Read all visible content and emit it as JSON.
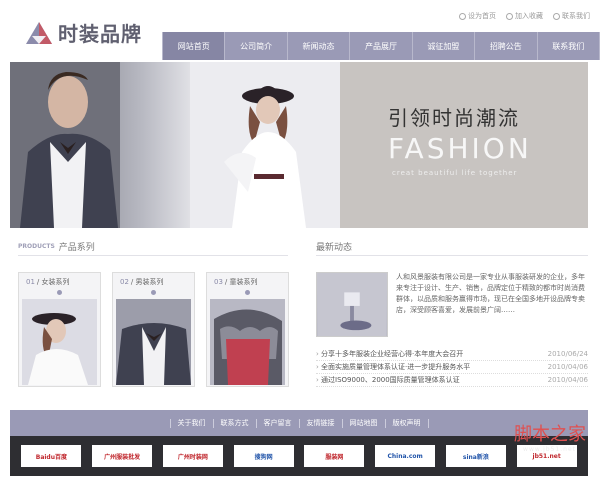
{
  "header": {
    "logo_text": "时装品牌",
    "toplinks": [
      "设为首页",
      "加入收藏",
      "联系我们"
    ]
  },
  "nav": [
    "网站首页",
    "公司简介",
    "新闻动态",
    "产品展厅",
    "诚征加盟",
    "招聘公告",
    "联系我们"
  ],
  "banner": {
    "slogan_cn": "引领时尚潮流",
    "slogan_en": "FASHION",
    "slogan_sub": "creat beautiful life together"
  },
  "products": {
    "head_en": "PRODUCTS",
    "head_cn": "产品系列",
    "items": [
      {
        "num": "01",
        "name": "女装系列"
      },
      {
        "num": "02",
        "name": "男装系列"
      },
      {
        "num": "03",
        "name": "童装系列"
      }
    ]
  },
  "news": {
    "head_cn": "最新动态",
    "summary": "人和风景服装有限公司是一家专业从事服装研发的企业，多年来专注于设计、生产、销售，品牌定位于精致的都市时尚消费群体，以品质和服务赢得市场，现已在全国多地开设品牌专卖店，深受顾客喜爱，发展前景广阔……",
    "items": [
      {
        "title": "分享十多年服装企业经营心得·本年度大会召开",
        "date": "2010/06/24"
      },
      {
        "title": "全面实施质量管理体系认证·进一步提升服务水平",
        "date": "2010/04/06"
      },
      {
        "title": "通过ISO9000、2000国际质量管理体系认证",
        "date": "2010/04/06"
      }
    ]
  },
  "footer": {
    "links": [
      "关于我们",
      "联系方式",
      "客户留言",
      "友情链接",
      "网站地图",
      "版权声明"
    ]
  },
  "partners": [
    {
      "name": "Baidu百度",
      "style": "red"
    },
    {
      "name": "广州服装批发",
      "style": "red"
    },
    {
      "name": "广州时装网",
      "style": "red"
    },
    {
      "name": "搜狗网",
      "style": "blue"
    },
    {
      "name": "服装网",
      "style": "red"
    },
    {
      "name": "China.com",
      "style": "blue"
    },
    {
      "name": "sina新浪",
      "style": "blue"
    },
    {
      "name": "jb51.net",
      "style": "red"
    }
  ],
  "watermark": {
    "cn": "脚本之家",
    "en": "www.jb51.net"
  },
  "colors": {
    "nav_bg": "#9a9ab6",
    "accent": "#8a8aa8",
    "footer_dark": "#2e2e32"
  }
}
